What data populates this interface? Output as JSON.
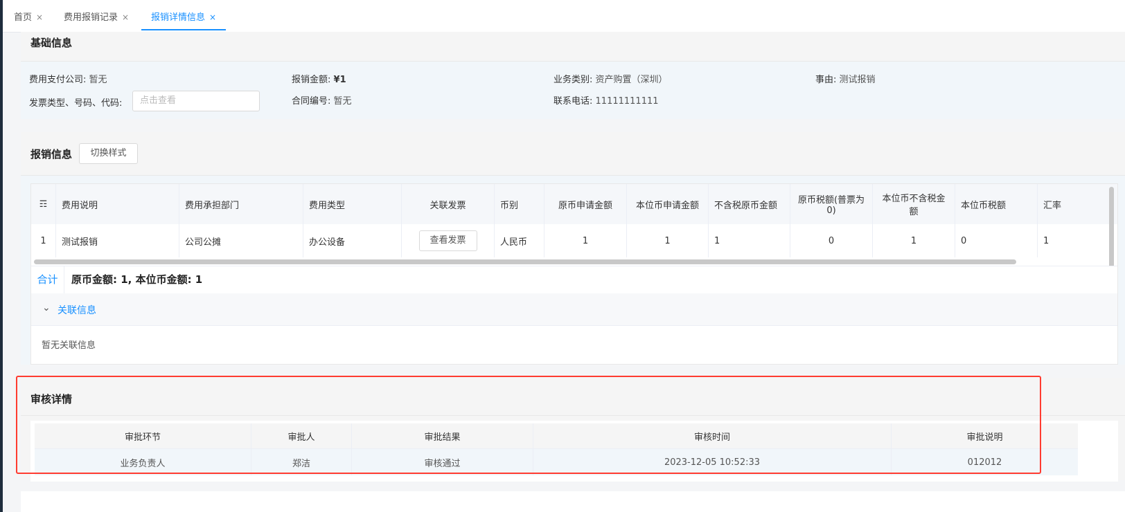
{
  "tabs": [
    {
      "label": "首页",
      "close": "×"
    },
    {
      "label": "费用报销记录",
      "close": "×"
    },
    {
      "label": "报销详情信息",
      "close": "×"
    }
  ],
  "basic_info": {
    "title": "基础信息",
    "fields": [
      {
        "label": "费用支付公司:",
        "value": "暂无"
      },
      {
        "label": "报销金额:",
        "value": "¥1"
      },
      {
        "label": "业务类别:",
        "value": "资产购置（深圳）"
      },
      {
        "label": "事由:",
        "value": "测试报销"
      },
      {
        "label": "发票类型、号码、代码:",
        "value": ""
      },
      {
        "label": "合同编号:",
        "value": "暂无"
      },
      {
        "label": "联系电话:",
        "value": "11111111111"
      }
    ],
    "invoice_placeholder": "点击查看"
  },
  "reimburse": {
    "title": "报销信息",
    "switch_button": "切换样式",
    "columns": [
      "☶",
      "费用说明",
      "费用承担部门",
      "费用类型",
      "关联发票",
      "币别",
      "原币申请金额",
      "本位币申请金额",
      "不含税原币金额",
      "原币税额(普票为0)",
      "本位币不含税金额",
      "本位币税额",
      "汇率"
    ],
    "row": {
      "index": "1",
      "desc": "测试报销",
      "dept": "公司公摊",
      "type": "办公设备",
      "invoice_btn": "查看发票",
      "currency": "人民币",
      "orig_apply": "1",
      "base_apply": "1",
      "orig_excl_tax": "1",
      "orig_tax": "0",
      "base_excl_tax": "1",
      "base_tax": "0",
      "rate": "1"
    },
    "sum_label": "合计",
    "sum_text": "原币金额: 1, 本位币金额: 1",
    "related_title": "关联信息",
    "related_empty": "暂无关联信息"
  },
  "audit": {
    "title": "审核详情",
    "columns": [
      "审批环节",
      "审批人",
      "审批结果",
      "审核时间",
      "审批说明"
    ],
    "row": [
      "业务负责人",
      "郑洁",
      "审核通过",
      "2023-12-05 10:52:33",
      "012012"
    ]
  },
  "colors": {
    "accent": "#1890ff",
    "highlight": "#ff3b30"
  }
}
